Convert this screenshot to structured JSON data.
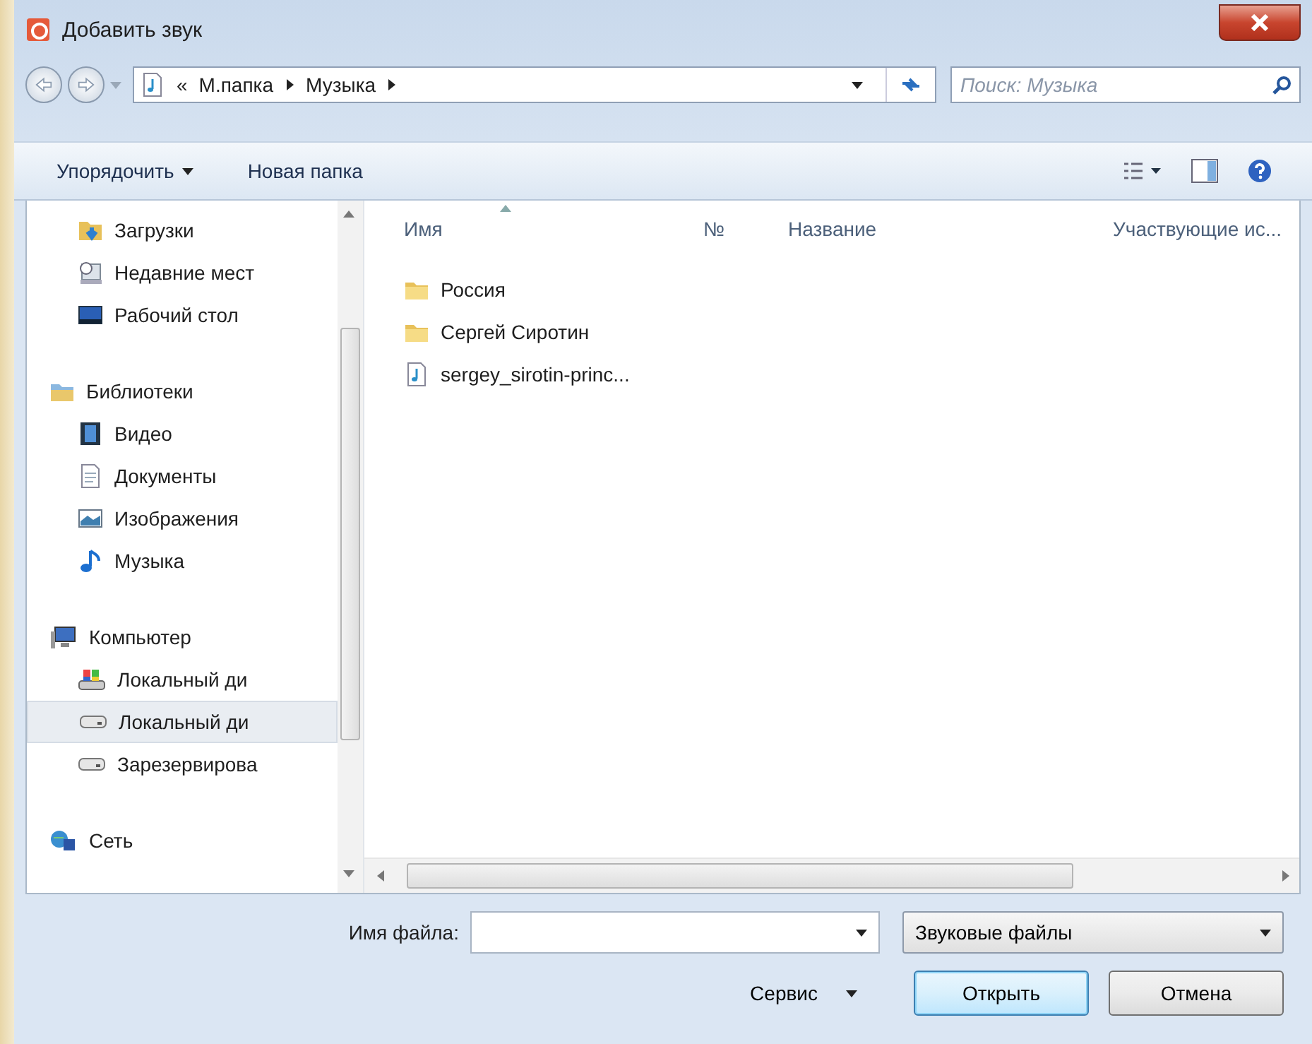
{
  "window": {
    "title": "Добавить звук"
  },
  "address": {
    "overflow": "«",
    "crumbs": [
      "М.папка",
      "Музыка"
    ]
  },
  "search": {
    "placeholder": "Поиск: Музыка"
  },
  "toolbar": {
    "organize": "Упорядочить",
    "new_folder": "Новая папка"
  },
  "nav": {
    "groups": [
      {
        "items": [
          {
            "label": "Загрузки",
            "kind": "downloads",
            "selected": false
          },
          {
            "label": "Недавние мест",
            "kind": "recent",
            "selected": false
          },
          {
            "label": "Рабочий стол",
            "kind": "desktop",
            "selected": false
          }
        ]
      },
      {
        "header": {
          "label": "Библиотеки",
          "kind": "library",
          "selected": false
        },
        "items": [
          {
            "label": "Видео",
            "kind": "video",
            "selected": false
          },
          {
            "label": "Документы",
            "kind": "document",
            "selected": false
          },
          {
            "label": "Изображения",
            "kind": "image",
            "selected": false
          },
          {
            "label": "Музыка",
            "kind": "music",
            "selected": false
          }
        ]
      },
      {
        "header": {
          "label": "Компьютер",
          "kind": "computer",
          "selected": false
        },
        "items": [
          {
            "label": "Локальный ди",
            "kind": "system-drive",
            "selected": false
          },
          {
            "label": "Локальный ди",
            "kind": "drive",
            "selected": true
          },
          {
            "label": "Зарезервирова",
            "kind": "drive",
            "selected": false
          }
        ]
      },
      {
        "header": {
          "label": "Сеть",
          "kind": "network",
          "selected": false
        }
      }
    ]
  },
  "table": {
    "columns": [
      "Имя",
      "№",
      "Название",
      "Участвующие ис..."
    ],
    "rows": [
      {
        "name": "Россия",
        "kind": "folder"
      },
      {
        "name": "Сергей Сиротин",
        "kind": "folder"
      },
      {
        "name": "sergey_sirotin-princ...",
        "kind": "audio"
      }
    ]
  },
  "footer": {
    "filename_label": "Имя файла:",
    "filetype": "Звуковые файлы",
    "service": "Сервис",
    "open": "Открыть",
    "cancel": "Отмена"
  }
}
